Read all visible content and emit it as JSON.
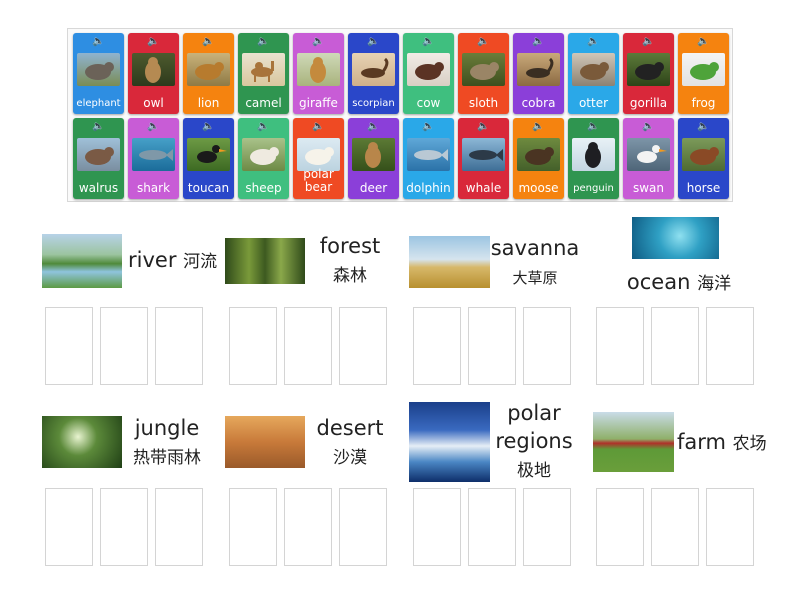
{
  "cards": [
    {
      "label": "elephant",
      "color": "#2e8ee2",
      "scene": "elephant",
      "small": true
    },
    {
      "label": "owl",
      "color": "#d9283a",
      "scene": "owl"
    },
    {
      "label": "lion",
      "color": "#f5830f",
      "scene": "lion"
    },
    {
      "label": "camel",
      "color": "#2f9550",
      "scene": "camel"
    },
    {
      "label": "giraffe",
      "color": "#c85cd6",
      "scene": "giraffe"
    },
    {
      "label": "scorpian",
      "color": "#2a47c9",
      "scene": "scorpian",
      "small": true
    },
    {
      "label": "cow",
      "color": "#3fbf7f",
      "scene": "cow"
    },
    {
      "label": "sloth",
      "color": "#ef4a23",
      "scene": "sloth"
    },
    {
      "label": "cobra",
      "color": "#8b3fd9",
      "scene": "cobra"
    },
    {
      "label": "otter",
      "color": "#2aa8e8",
      "scene": "otter"
    },
    {
      "label": "gorilla",
      "color": "#d9283a",
      "scene": "gorilla"
    },
    {
      "label": "frog",
      "color": "#f5830f",
      "scene": "frog"
    },
    {
      "label": "walrus",
      "color": "#2f9550",
      "scene": "walrus"
    },
    {
      "label": "shark",
      "color": "#c85cd6",
      "scene": "shark"
    },
    {
      "label": "toucan",
      "color": "#2a47c9",
      "scene": "toucan"
    },
    {
      "label": "sheep",
      "color": "#3fbf7f",
      "scene": "sheep"
    },
    {
      "label": "polar bear",
      "color": "#ef4a23",
      "scene": "polarbear",
      "two": true
    },
    {
      "label": "deer",
      "color": "#8b3fd9",
      "scene": "deer"
    },
    {
      "label": "dolphin",
      "color": "#2aa8e8",
      "scene": "dolphin"
    },
    {
      "label": "whale",
      "color": "#d9283a",
      "scene": "whale"
    },
    {
      "label": "moose",
      "color": "#f5830f",
      "scene": "moose"
    },
    {
      "label": "penguin",
      "color": "#2f9550",
      "scene": "penguin",
      "small": true
    },
    {
      "label": "swan",
      "color": "#c85cd6",
      "scene": "swan"
    },
    {
      "label": "horse",
      "color": "#2a47c9",
      "scene": "horse"
    }
  ],
  "speaker_glyph": "🔈",
  "habitats": [
    {
      "id": "river",
      "label": "river",
      "cn": "河流"
    },
    {
      "id": "forest",
      "label": "forest",
      "cn": "森林"
    },
    {
      "id": "savanna",
      "label": "savanna",
      "cn": "大草原"
    },
    {
      "id": "ocean",
      "label": "ocean",
      "cn": "海洋"
    },
    {
      "id": "jungle",
      "label": "jungle",
      "cn": "热带雨林"
    },
    {
      "id": "desert",
      "label": "desert",
      "cn": "沙漠"
    },
    {
      "id": "polar",
      "label": "polar regions",
      "cn": "极地"
    },
    {
      "id": "farm",
      "label": "farm",
      "cn": "农场"
    }
  ]
}
